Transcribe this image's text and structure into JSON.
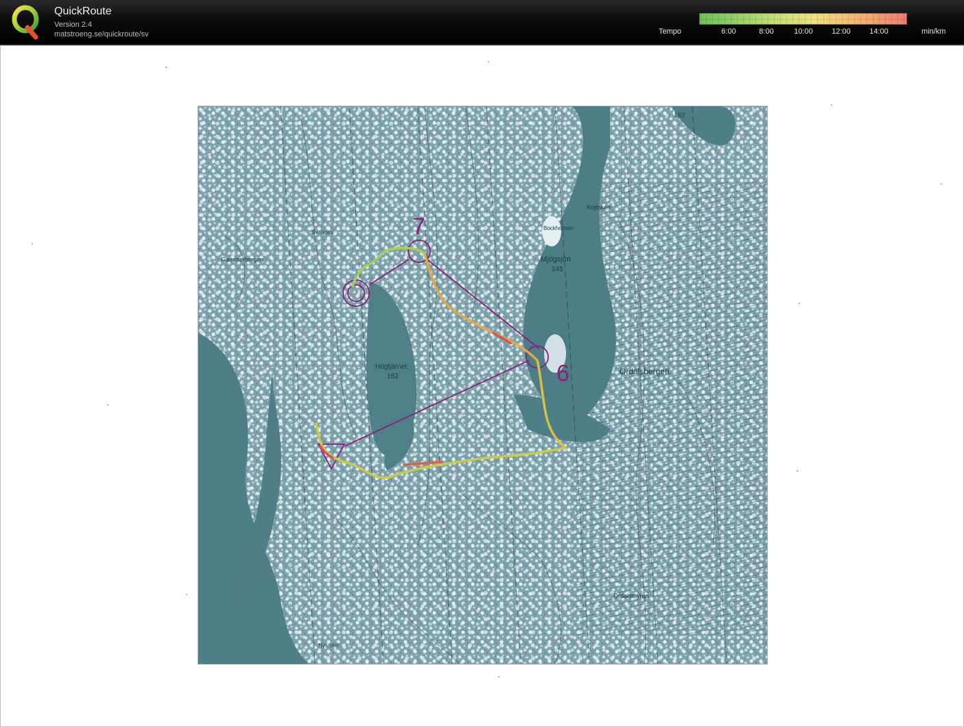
{
  "app": {
    "title": "QuickRoute",
    "version": "Version 2.4",
    "url": "matstroeng.se/quickroute/sv"
  },
  "legend": {
    "label": "Tempo",
    "unit": "min/km",
    "ticks": [
      "6:00",
      "8:00",
      "10:00",
      "12:00",
      "14:00"
    ]
  },
  "map": {
    "control_labels": [
      "7",
      "6"
    ],
    "place_names": {
      "mjogsjon": "Mjögsjön",
      "mjogsjon_elev": "145",
      "hogtjarnet": "Högtjärnet",
      "hogtjarnet_elev": "162",
      "ordalsbergen": "Ordalsbergen",
      "gammelbergen": "Gammelbergen",
      "bockholmen": "Bockholmen",
      "kojtnken": "Kojtnken",
      "ordalsmyren": "Ordalsmyren",
      "nysatern": "Nysätern",
      "svangas": "Svangas",
      "elev_162_top": "162"
    }
  },
  "colors": {
    "header_bg": "#000000",
    "course": "#8b1f7a",
    "route_fast": "#8fcf56",
    "route_mid": "#e2c64a",
    "route_slow": "#d9534f",
    "water": "#4f7f88",
    "terrain": "#7fa6b2"
  }
}
